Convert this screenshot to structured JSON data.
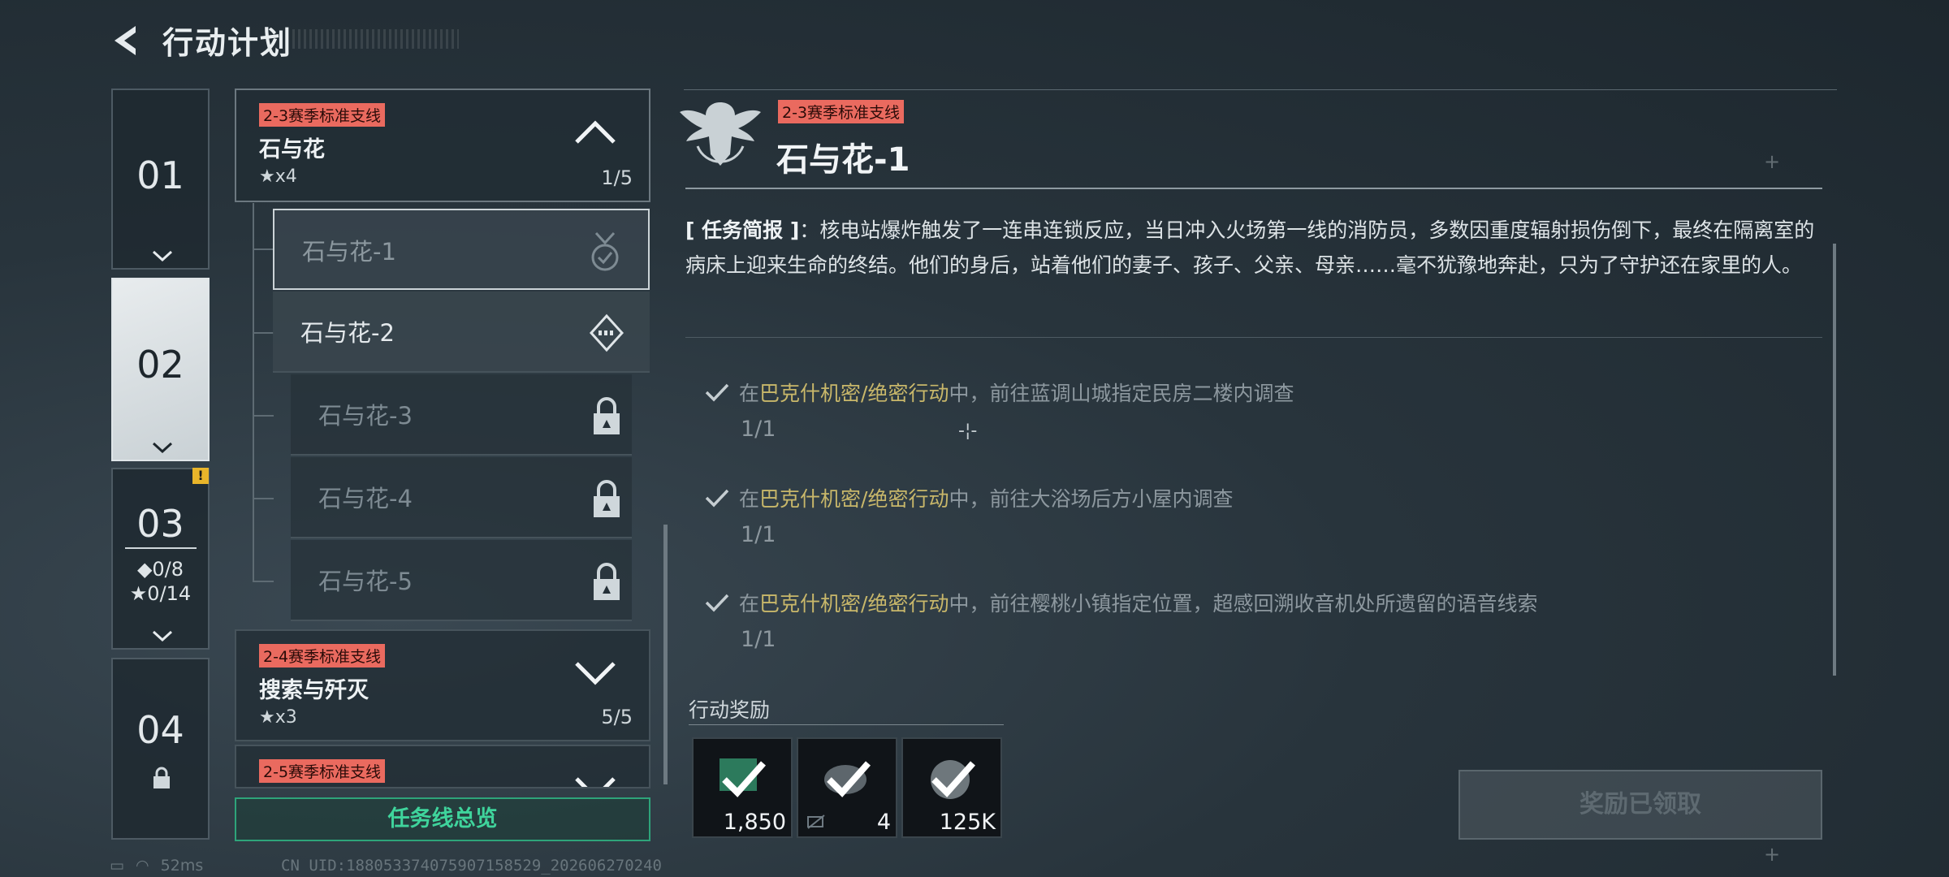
{
  "header": {
    "title": "行动计划"
  },
  "chapters": [
    {
      "num": "01"
    },
    {
      "num": "02"
    },
    {
      "num": "03",
      "gems": "◆0/8",
      "stars": "★0/14",
      "badge": "!"
    },
    {
      "num": "04"
    }
  ],
  "mission_groups": [
    {
      "tag": "2-3赛季标准支线",
      "name": "石与花",
      "stars": "★x4",
      "progress": "1/5",
      "expanded": true
    },
    {
      "tag": "2-4赛季标准支线",
      "name": "搜索与歼灭",
      "stars": "★x3",
      "progress": "5/5",
      "expanded": false
    },
    {
      "tag": "2-5赛季标准支线"
    }
  ],
  "sub_missions": [
    {
      "name": "石与花-1",
      "state": "completed"
    },
    {
      "name": "石与花-2",
      "state": "available"
    },
    {
      "name": "石与花-3",
      "state": "locked"
    },
    {
      "name": "石与花-4",
      "state": "locked"
    },
    {
      "name": "石与花-5",
      "state": "locked"
    }
  ],
  "overview_button": "任务线总览",
  "detail": {
    "tag": "2-3赛季标准支线",
    "title": "石与花-1",
    "brief_label": "[ 任务简报 ]",
    "brief_text": "：核电站爆炸触发了一连串连锁反应，当日冲入火场第一线的消防员，多数因重度辐射损伤倒下，最终在隔离室的病床上迎来生命的终结。他们的身后，站着他们的妻子、孩子、父亲、母亲……毫不犹豫地奔赴，只为了守护还在家里的人。",
    "objectives": [
      {
        "pre": "在",
        "hl": "巴克什机密/绝密行动",
        "post": "中，前往蓝调山城指定民房二楼内调查",
        "count": "1/1"
      },
      {
        "pre": "在",
        "hl": "巴克什机密/绝密行动",
        "post": "中，前往大浴场后方小屋内调查",
        "count": "1/1"
      },
      {
        "pre": "在",
        "hl": "巴克什机密/绝密行动",
        "post": "中，前往樱桃小镇指定位置，超感回溯收音机处所遗留的语音线索",
        "count": "1/1"
      }
    ],
    "rewards_title": "行动奖励",
    "rewards": [
      {
        "qty": "1,850"
      },
      {
        "qty": "4"
      },
      {
        "qty": "125K"
      }
    ],
    "claim_button": "奖励已领取"
  },
  "status": {
    "ping": "52ms",
    "uid": "CN UID:18805337407590715852​9_202606270240"
  },
  "colors": {
    "accent_green": "#3fd49c",
    "tag_red": "#ea6a5f",
    "highlight_gold": "#c8b76a"
  }
}
